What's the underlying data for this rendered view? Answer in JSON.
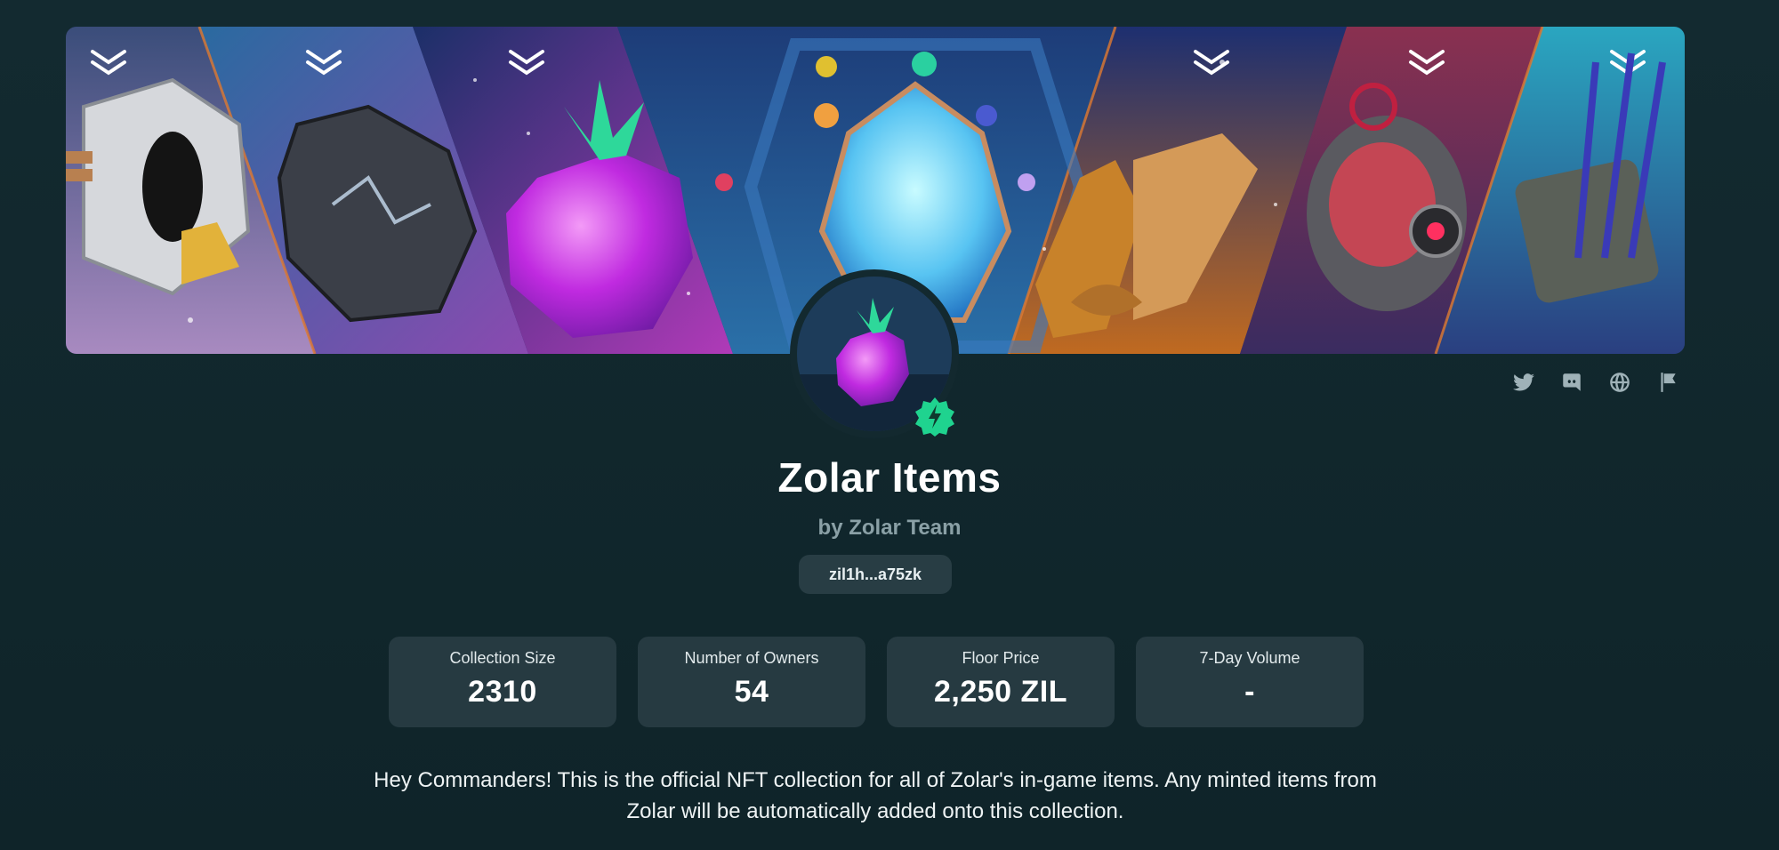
{
  "collection": {
    "title": "Zolar Items",
    "creator": "by Zolar Team",
    "address": "zil1h...a75zk",
    "description": "Hey Commanders! This is the official NFT collection for all of Zolar's in-game items. Any minted items from Zolar will be automatically added onto this collection."
  },
  "socials": [
    {
      "icon": "twitter-icon"
    },
    {
      "icon": "discord-icon"
    },
    {
      "icon": "globe-icon"
    },
    {
      "icon": "flag-icon"
    }
  ],
  "stats": [
    {
      "label": "Collection Size",
      "value": "2310"
    },
    {
      "label": "Number of Owners",
      "value": "54"
    },
    {
      "label": "Floor Price",
      "value": "2,250 ZIL"
    },
    {
      "label": "7-Day Volume",
      "value": "-"
    }
  ],
  "colors": {
    "background": "#132a30",
    "card": "#263a41",
    "verified_badge": "#1fd38f",
    "muted_text": "#8aa0a6"
  }
}
